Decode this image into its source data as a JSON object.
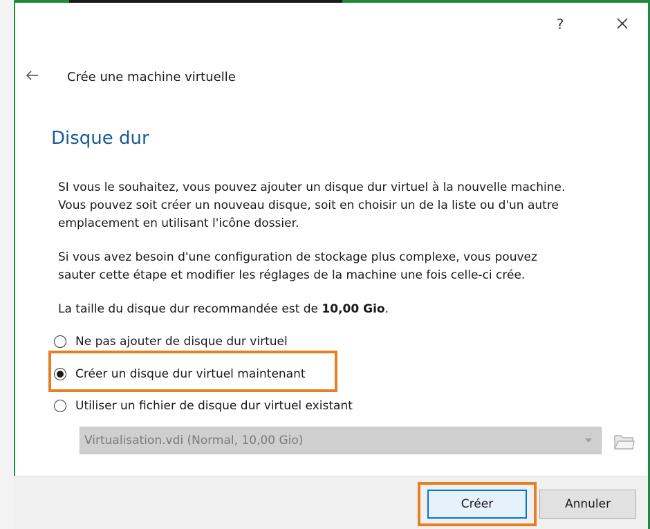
{
  "titlebar": {
    "help_label": "?",
    "close_icon": "close-icon"
  },
  "wizard": {
    "back_icon": "back-arrow-icon",
    "title": "Crée une machine virtuelle"
  },
  "section": {
    "title": "Disque dur",
    "para1_line1": "SI vous le souhaitez, vous pouvez ajouter un disque dur virtuel à la nouvelle machine.",
    "para1_line2": "Vous pouvez soit créer un nouveau disque, soit en choisir un de la liste ou d'un autre",
    "para1_line3": "emplacement en utilisant l'icône dossier.",
    "para2_line1": "Si vous avez besoin d'une configuration de stockage plus complexe, vous pouvez",
    "para2_line2": "sauter cette étape et modifier les réglages de la machine une fois celle-ci crée.",
    "para3_prefix": "La taille du disque dur recommandée est de ",
    "para3_value": "10,00 Gio",
    "para3_suffix": "."
  },
  "options": [
    {
      "label": "Ne pas ajouter de disque dur virtuel",
      "selected": false
    },
    {
      "label": "Créer un disque dur virtuel maintenant",
      "selected": true
    },
    {
      "label": "Utiliser un fichier de disque dur virtuel existant",
      "selected": false
    }
  ],
  "disk_select": {
    "value": "Virtualisation.vdi (Normal, 10,00 Gio)",
    "enabled": false
  },
  "buttons": {
    "create_label": "Créer",
    "cancel_label": "Annuler"
  },
  "colors": {
    "accent": "#1c5a96",
    "highlight": "#e67e22",
    "window_border": "#1f8a3c",
    "focus": "#0078d7"
  }
}
